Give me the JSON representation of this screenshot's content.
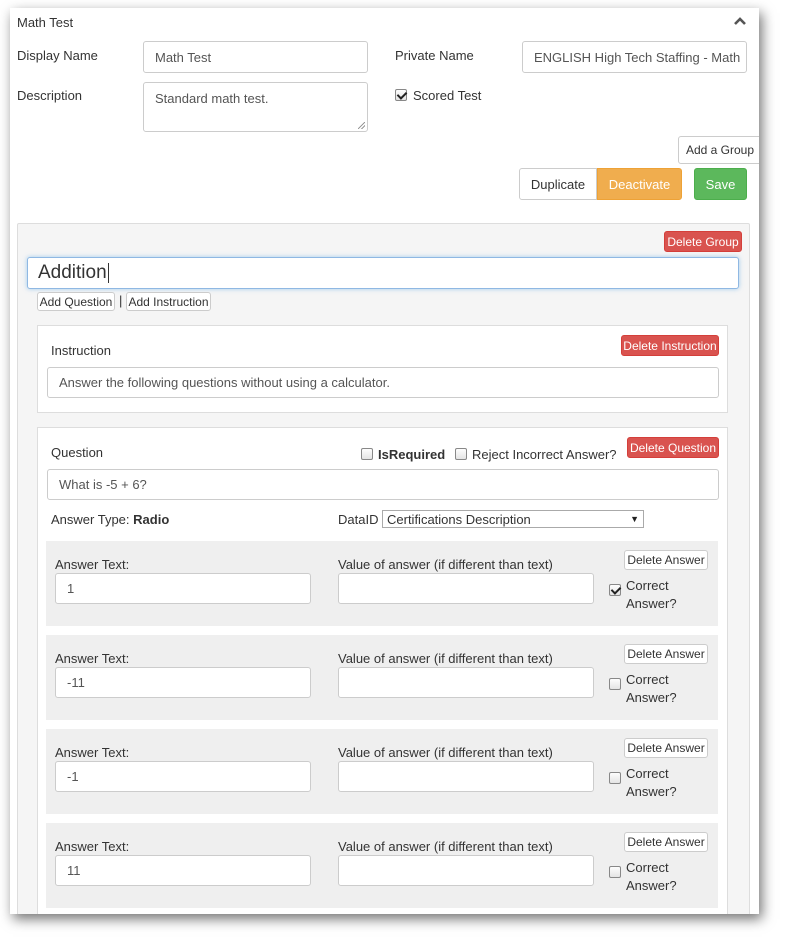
{
  "header": {
    "title": "Math Test"
  },
  "form": {
    "display_name_label": "Display Name",
    "display_name_value": "Math Test",
    "private_name_label": "Private Name",
    "private_name_value": "ENGLISH High Tech Staffing - Math",
    "description_label": "Description",
    "description_value": "Standard math test.",
    "scored_label": "Scored Test",
    "scored_checked": true
  },
  "actions": {
    "add_group": "Add a Group",
    "duplicate": "Duplicate",
    "deactivate": "Deactivate",
    "save": "Save"
  },
  "group": {
    "delete_group": "Delete Group",
    "name": "Addition",
    "add_question": "Add Question",
    "separator": "|",
    "add_instruction": "Add Instruction",
    "instruction": {
      "label": "Instruction",
      "delete": "Delete Instruction",
      "text": "Answer the following questions without using a calculator."
    },
    "question": {
      "label": "Question",
      "is_required_label": "IsRequired",
      "reject_label": "Reject Incorrect Answer?",
      "delete": "Delete Question",
      "text": "What is -5 + 6?",
      "answer_type_label": "Answer Type:",
      "answer_type_value": "Radio",
      "dataid_label": "DataID",
      "dataid_value": "Certifications Description",
      "answers": [
        {
          "text_label": "Answer Text:",
          "text": "1",
          "value_label": "Value of answer (if different than text)",
          "value": "",
          "delete": "Delete Answer",
          "correct_line1": "Correct",
          "correct_line2": "Answer?",
          "correct": true
        },
        {
          "text_label": "Answer Text:",
          "text": "-11",
          "value_label": "Value of answer (if different than text)",
          "value": "",
          "delete": "Delete Answer",
          "correct_line1": "Correct",
          "correct_line2": "Answer?",
          "correct": false
        },
        {
          "text_label": "Answer Text:",
          "text": "-1",
          "value_label": "Value of answer (if different than text)",
          "value": "",
          "delete": "Delete Answer",
          "correct_line1": "Correct",
          "correct_line2": "Answer?",
          "correct": false
        },
        {
          "text_label": "Answer Text:",
          "text": "11",
          "value_label": "Value of answer (if different than text)",
          "value": "",
          "delete": "Delete Answer",
          "correct_line1": "Correct",
          "correct_line2": "Answer?",
          "correct": false
        }
      ]
    }
  }
}
